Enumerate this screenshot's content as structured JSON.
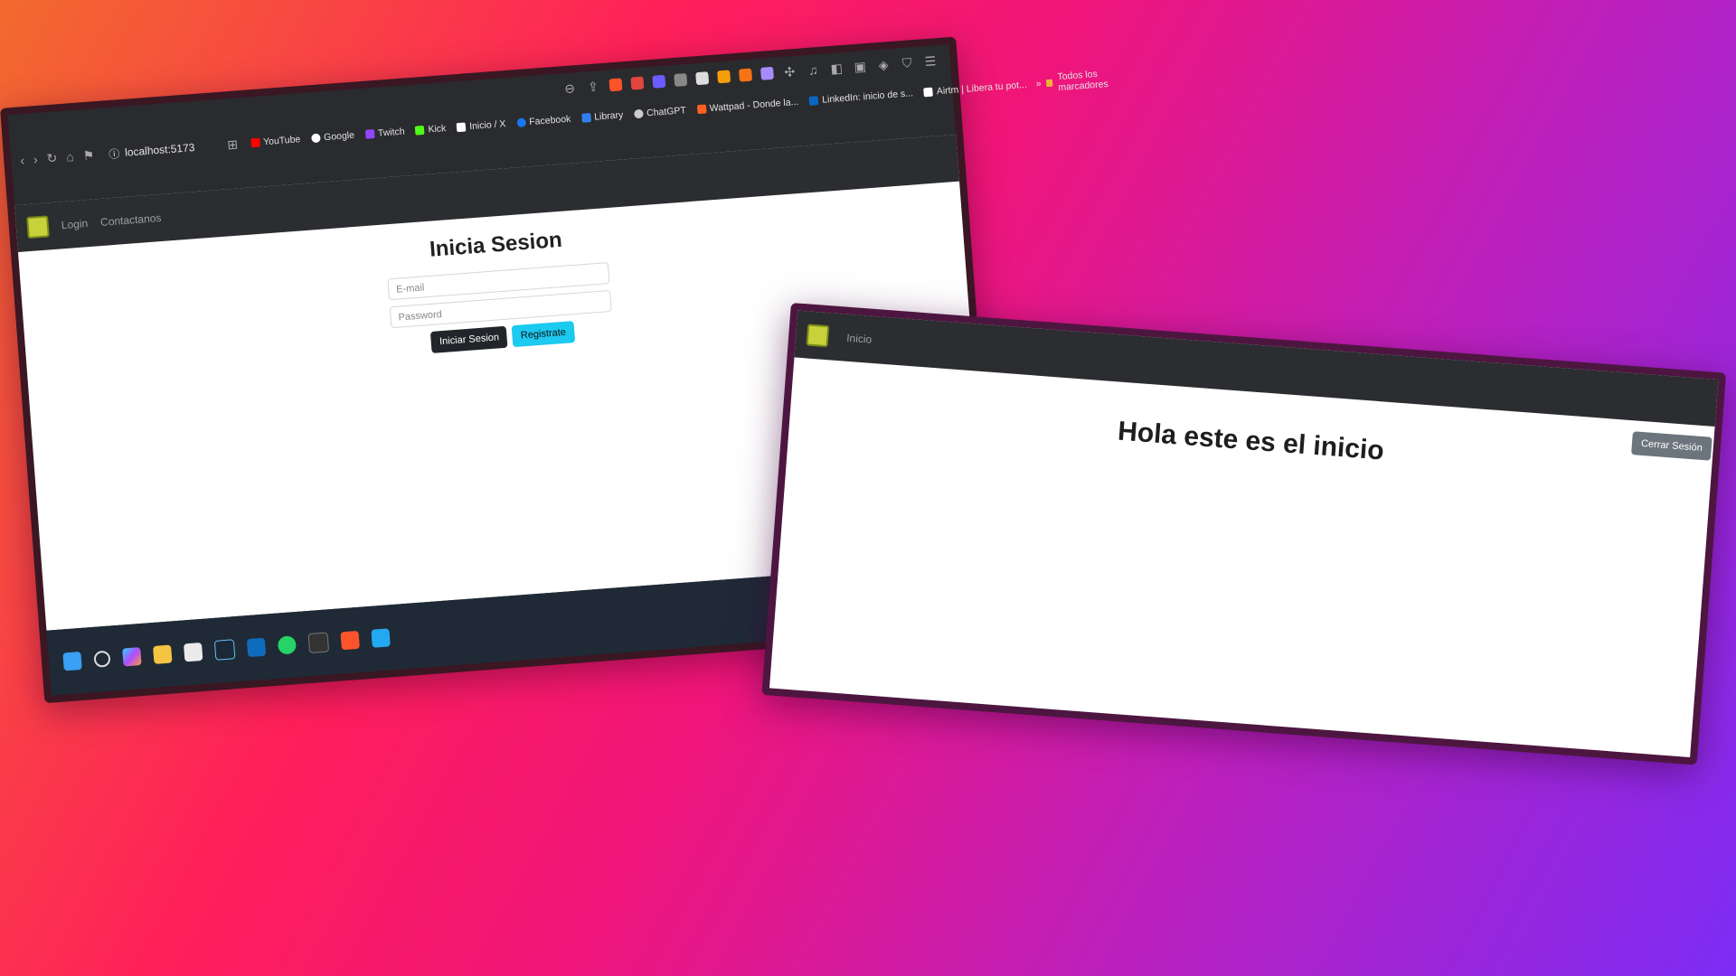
{
  "left_window": {
    "browser": {
      "url": "localhost:5173",
      "bookmarks": [
        {
          "label": "YouTube",
          "color": "#ff0000"
        },
        {
          "label": "Google",
          "color": "#ffffff"
        },
        {
          "label": "Twitch",
          "color": "#9146ff"
        },
        {
          "label": "Kick",
          "color": "#53fc18"
        },
        {
          "label": "Inicio / X",
          "color": "#ffffff"
        },
        {
          "label": "Facebook",
          "color": "#1877f2"
        },
        {
          "label": "Library",
          "color": "#2f80ed"
        },
        {
          "label": "ChatGPT",
          "color": "#cccccc"
        },
        {
          "label": "Wattpad - Donde la...",
          "color": "#ff6122"
        },
        {
          "label": "LinkedIn: inicio de s...",
          "color": "#0a66c2"
        },
        {
          "label": "Airtm | Libera tu pot...",
          "color": "#ffffff"
        }
      ],
      "more_bookmarks": "»",
      "bookmarks_folder": "Todos los marcadores",
      "nav_glyphs": {
        "back": "‹",
        "forward": "›",
        "reload": "↻",
        "home": "⌂",
        "bookmark": "⚑",
        "info": "ⓘ"
      }
    },
    "app": {
      "nav_links": [
        "Login",
        "Contactanos"
      ],
      "title": "Inicia Sesion",
      "email_placeholder": "E-mail",
      "password_placeholder": "Password",
      "login_button": "Iniciar Sesion",
      "register_button": "Registrate"
    },
    "taskbar_icons": [
      "windows-start-icon",
      "search-icon",
      "copilot-icon",
      "file-explorer-icon",
      "store-icon",
      "steam-icon",
      "outlook-icon",
      "whatsapp-icon",
      "terminal-icon",
      "brave-icon",
      "vscode-icon"
    ]
  },
  "right_window": {
    "nav_link": "Inicio",
    "logout_button": "Cerrar Sesión",
    "heading": "Hola este es el inicio"
  },
  "colors": {
    "navbar": "#2b2d30",
    "accent_cyan": "#1ccaf0",
    "dark_button": "#212529",
    "logout_gray": "#6c757d"
  }
}
